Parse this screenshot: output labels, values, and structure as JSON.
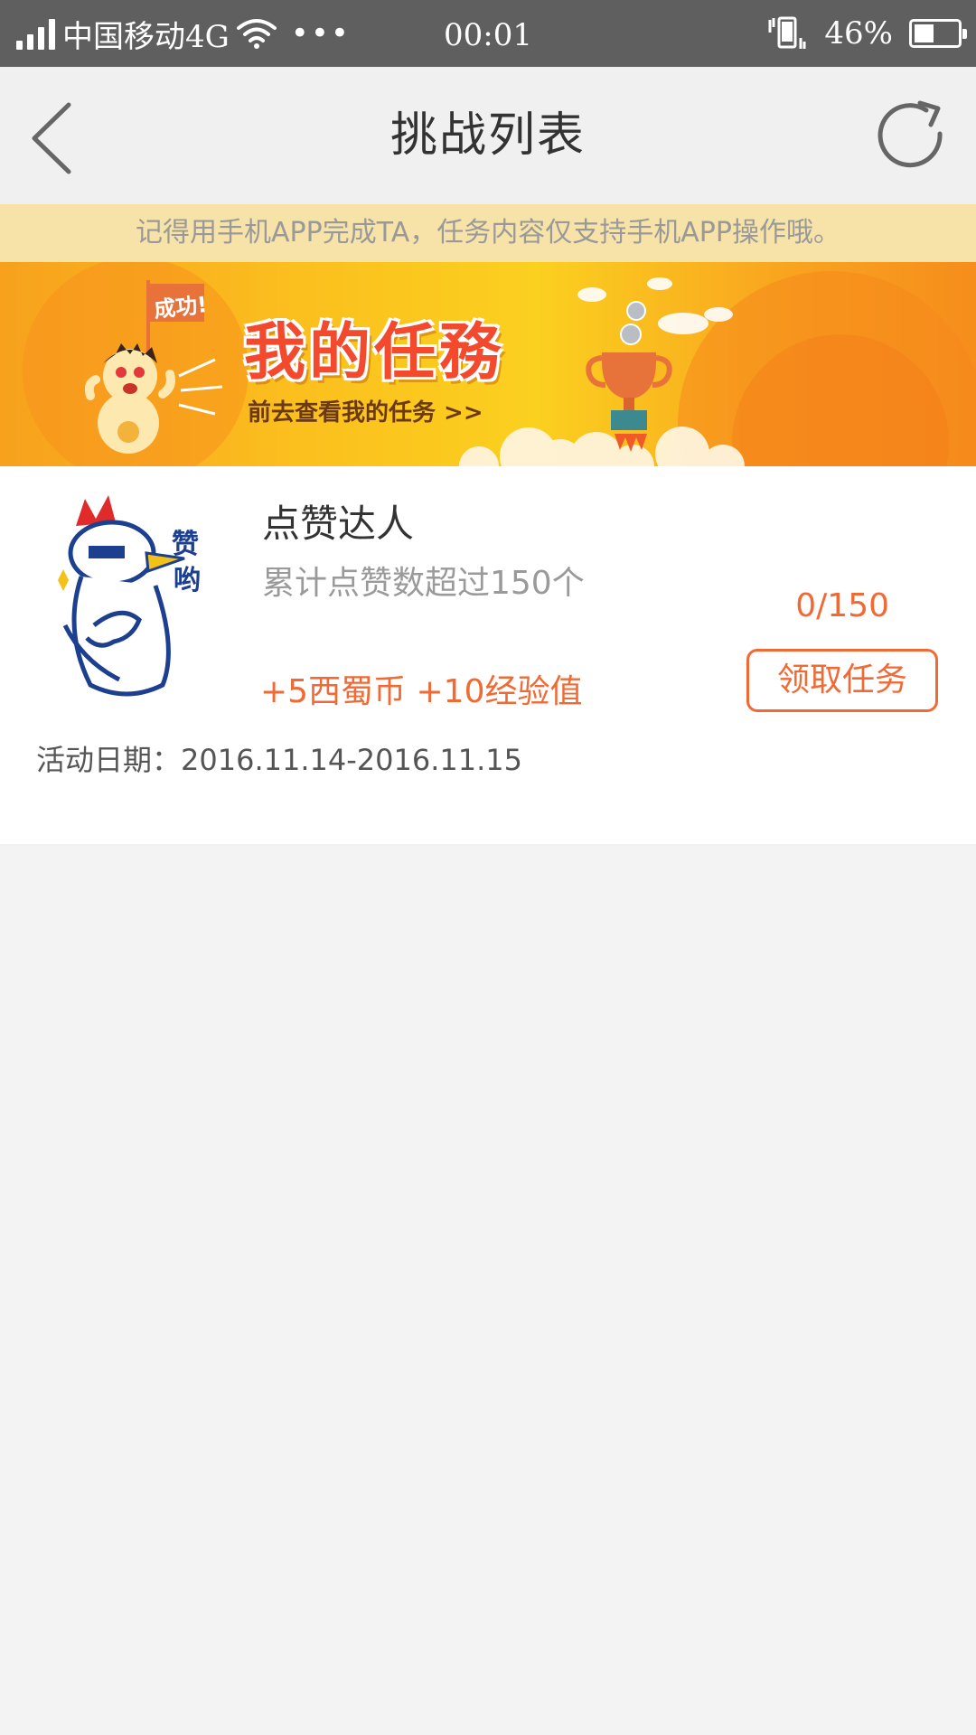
{
  "status_bar": {
    "carrier": "中国移动4G",
    "more": "•••",
    "time": "00:01",
    "battery_percent": "46%",
    "battery_level": 0.46,
    "icons": [
      "signal-icon",
      "wifi-icon",
      "vibrate-icon",
      "battery-icon"
    ]
  },
  "nav": {
    "title": "挑战列表",
    "back_icon": "chevron-left-icon",
    "refresh_icon": "refresh-icon"
  },
  "notice": {
    "text": "记得用手机APP完成TA，任务内容仅支持手机APP操作哦。"
  },
  "banner": {
    "flag_text": "成功!",
    "title": "我的任務",
    "subtitle": "前去查看我的任务 >>"
  },
  "tasks": [
    {
      "icon": "rooster-thumbs-up-icon",
      "icon_text": "赞哟",
      "name": "点赞达人",
      "description": "累计点赞数超过150个",
      "reward": "+5西蜀币 +10经验值",
      "progress": "0/150",
      "button_label": "领取任务",
      "date": "活动日期：2016.11.14-2016.11.15"
    }
  ],
  "colors": {
    "accent": "#f06a35",
    "status_bar": "#5f5f5f",
    "notice_bg": "#f7e3a8",
    "banner_title": "#f3492d"
  }
}
